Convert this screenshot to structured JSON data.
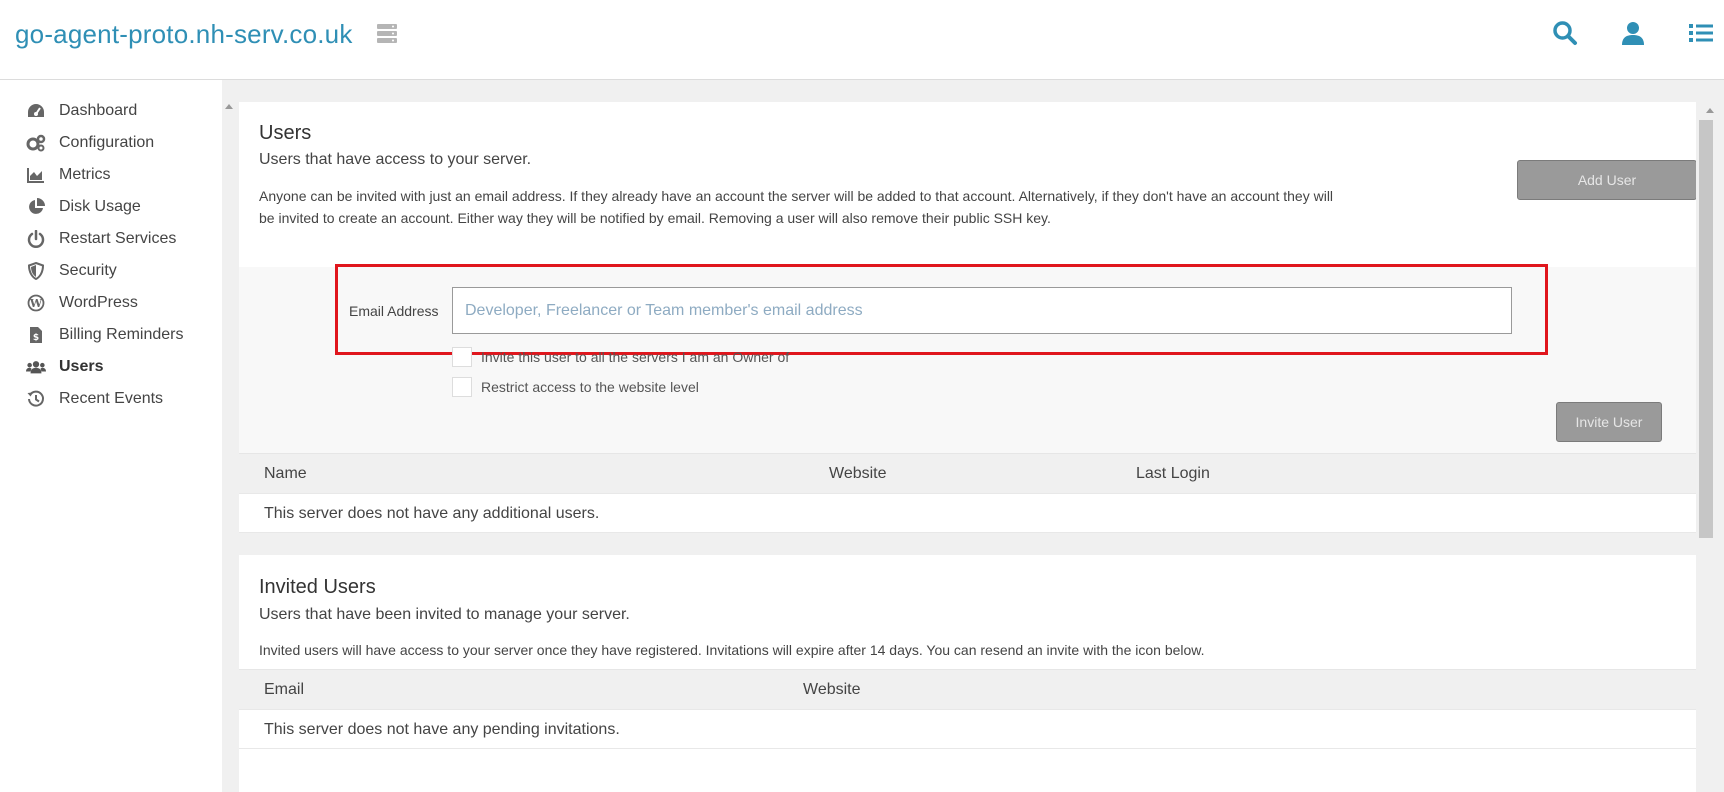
{
  "header": {
    "site_title": "go-agent-proto.nh-serv.co.uk",
    "icons": [
      "server-icon",
      "search-icon",
      "user-icon",
      "list-icon"
    ]
  },
  "sidebar": {
    "items": [
      {
        "label": "Dashboard",
        "icon": "tachometer-icon",
        "active": false
      },
      {
        "label": "Configuration",
        "icon": "cogs-icon",
        "active": false
      },
      {
        "label": "Metrics",
        "icon": "area-chart-icon",
        "active": false
      },
      {
        "label": "Disk Usage",
        "icon": "pie-chart-icon",
        "active": false
      },
      {
        "label": "Restart Services",
        "icon": "power-icon",
        "active": false
      },
      {
        "label": "Security",
        "icon": "shield-icon",
        "active": false
      },
      {
        "label": "WordPress",
        "icon": "wordpress-icon",
        "active": false
      },
      {
        "label": "Billing Reminders",
        "icon": "invoice-icon",
        "active": false
      },
      {
        "label": "Users",
        "icon": "users-icon",
        "active": true
      },
      {
        "label": "Recent Events",
        "icon": "history-icon",
        "active": false
      }
    ]
  },
  "users_panel": {
    "title": "Users",
    "subtitle": "Users that have access to your server.",
    "description": "Anyone can be invited with just an email address. If they already have an account the server will be added to that account. Alternatively, if they don't have an account they will be invited to create an account. Either way they will be notified by email. Removing a user will also remove their public SSH key.",
    "add_user_label": "Add User",
    "email_label": "Email Address",
    "email_value": "",
    "email_placeholder": "Developer, Freelancer or Team member's email address",
    "checkbox_all_servers": "Invite this user to all the servers I am an Owner of",
    "checkbox_restrict": "Restrict access to the website level",
    "invite_user_label": "Invite User",
    "table": {
      "columns": [
        "Name",
        "Website",
        "Last Login"
      ],
      "empty_message": "This server does not have any additional users."
    }
  },
  "invited_panel": {
    "title": "Invited Users",
    "subtitle": "Users that have been invited to manage your server.",
    "description": "Invited users will have access to your server once they have registered. Invitations will expire after 14 days. You can resend an invite with the icon below.",
    "table": {
      "columns": [
        "Email",
        "Website"
      ],
      "empty_message": "This server does not have any pending invitations."
    }
  },
  "colors": {
    "brand": "#2f8fb5",
    "highlight": "#e0161d",
    "button_disabled": "#9a9a9a"
  }
}
